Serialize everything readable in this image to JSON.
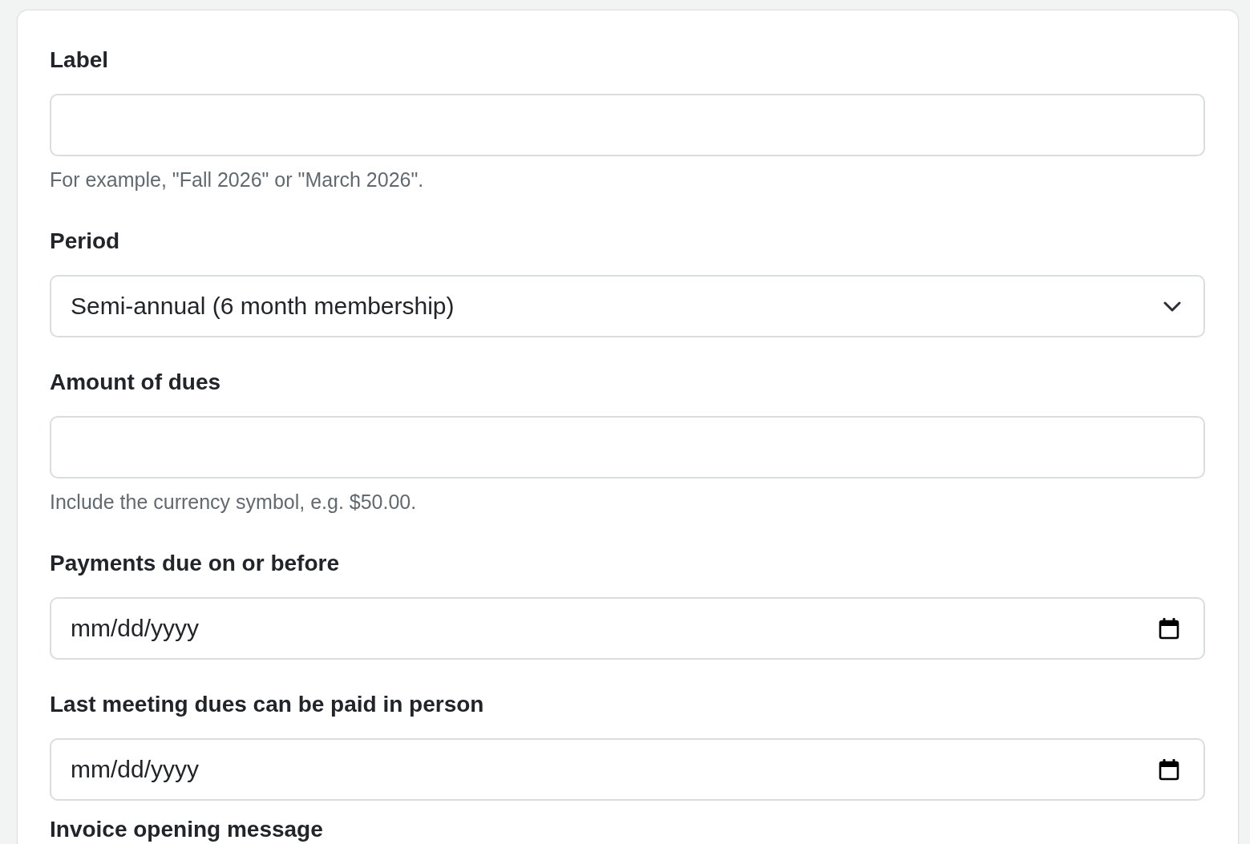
{
  "fields": [
    {
      "kind": "text",
      "label": "Label",
      "hint": "For example, \"Fall 2026\" or \"March 2026\"."
    },
    {
      "kind": "select",
      "label": "Period",
      "value": "Semi-annual (6 month membership)"
    },
    {
      "kind": "text",
      "label": "Amount of dues",
      "hint": "Include the currency symbol, e.g. $50.00."
    },
    {
      "kind": "date",
      "label": "Payments due on or before",
      "placeholder": "mm/dd/yyyy"
    },
    {
      "kind": "date",
      "label": "Last meeting dues can be paid in person",
      "placeholder": "mm/dd/yyyy"
    },
    {
      "kind": "label",
      "label": "Invoice opening message"
    }
  ]
}
